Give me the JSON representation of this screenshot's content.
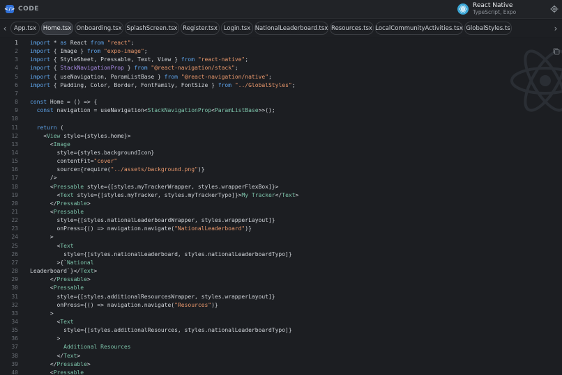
{
  "header": {
    "code_label": "CODE",
    "framework_title": "React Native",
    "framework_subtitle": "TypeScript, Expo"
  },
  "tabs": [
    {
      "label": "App.tsx",
      "active": false
    },
    {
      "label": "Home.tsx",
      "active": true
    },
    {
      "label": "Onboarding.tsx",
      "active": false
    },
    {
      "label": "SplashScreen.tsx",
      "active": false
    },
    {
      "label": "Register.tsx",
      "active": false
    },
    {
      "label": "Login.tsx",
      "active": false
    },
    {
      "label": "NationalLeaderboard.tsx",
      "active": false
    },
    {
      "label": "Resources.tsx",
      "active": false
    },
    {
      "label": "LocalCommunityActivities.tsx",
      "active": false
    },
    {
      "label": "GlobalStyles.ts",
      "active": false
    }
  ],
  "editor": {
    "current_line": 1,
    "lines": [
      "import * as React from \"react\";",
      "import { Image } from \"expo-image\";",
      "import { StyleSheet, Pressable, Text, View } from \"react-native\";",
      "import { StackNavigationProp } from \"@react-navigation/stack\";",
      "import { useNavigation, ParamListBase } from \"@react-navigation/native\";",
      "import { Padding, Color, Border, FontFamily, FontSize } from \"../GlobalStyles\";",
      "",
      "const Home = () => {",
      "  const navigation = useNavigation<StackNavigationProp<ParamListBase>>();",
      "",
      "  return (",
      "    <View style={styles.home}>",
      "      <Image",
      "        style={styles.backgroundIcon}",
      "        contentFit=\"cover\"",
      "        source={require(\"../assets/background.png\")}",
      "      />",
      "      <Pressable style={[styles.myTrackerWrapper, styles.wrapperFlexBox]}>",
      "        <Text style={[styles.myTracker, styles.myTrackerTypo]}>My Tracker</Text>",
      "      </Pressable>",
      "      <Pressable",
      "        style={[styles.nationalLeaderboardWrapper, styles.wrapperLayout]}",
      "        onPress={() => navigation.navigate(\"NationalLeaderboard\")}",
      "      >",
      "        <Text",
      "          style={[styles.nationalLeaderboard, styles.nationalLeaderboardTypo]}",
      "        >{`National",
      "Leaderboard`}</Text>",
      "      </Pressable>",
      "      <Pressable",
      "        style={[styles.additionalResourcesWrapper, styles.wrapperLayout]}",
      "        onPress={() => navigation.navigate(\"Resources\")}",
      "      >",
      "        <Text",
      "          style={[styles.additionalResources, styles.nationalLeaderboardTypo]}",
      "        >",
      "          Additional Resources",
      "        </Text>",
      "      </Pressable>",
      "      <Pressable"
    ]
  },
  "colors": {
    "keyword": "#5da2e8",
    "string": "#e8976b",
    "jsx_tag": "#7cc2a9",
    "type_param": "#a98be6",
    "text": "#cfd3d8"
  }
}
